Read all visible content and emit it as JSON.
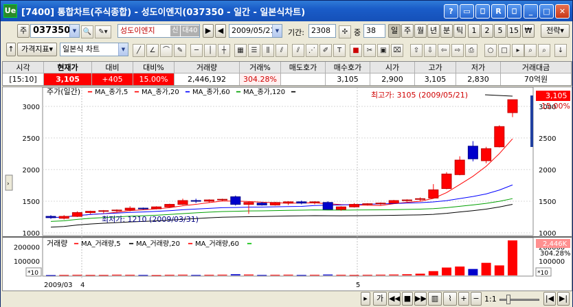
{
  "window": {
    "title": "[7400] 통합차트(주식종합) - 성도이엔지(037350 - 일간 - 일본식차트)",
    "app_icon_label": "Ue",
    "title_buttons": [
      "?",
      "▭",
      "⎕",
      "R",
      "⎕",
      "_",
      "□",
      "✕"
    ]
  },
  "toolbar1": {
    "market_prefix": "주",
    "code": "037350",
    "stock_name": "성도이엔지",
    "badge1": "신",
    "badge2": "대40",
    "date": "2009/05/21",
    "period_label": "기간:",
    "period_value": "2308",
    "count_label": "중",
    "count_value": "38",
    "period_buttons": [
      "일",
      "주",
      "월",
      "년",
      "분",
      "틱",
      "1",
      "2",
      "5",
      "15",
      "₩"
    ],
    "strategy_label": "전략"
  },
  "toolbar2": {
    "indicator_label": "가격지표",
    "chart_type": "일본식 차트"
  },
  "info": {
    "headers": [
      "시각",
      "현재가",
      "대비",
      "대비%",
      "거래량",
      "거래%",
      "매도호가",
      "매수호가",
      "시가",
      "고가",
      "저가",
      "거래대금"
    ],
    "values": [
      "[15:10]",
      "3,105",
      "+405",
      "15.00%",
      "2,446,192",
      "304.28%",
      "",
      "3,105",
      "2,900",
      "3,105",
      "2,830",
      "70억원"
    ]
  },
  "price_panel": {
    "title": "주가(일간)",
    "ma_labels": [
      "MA_종가,5",
      "MA_종가,20",
      "MA_종가,60",
      "MA_종가,120"
    ],
    "ma_colors": [
      "#ff0000",
      "#ff0000",
      "#0000ff",
      "#00a000",
      "#000000"
    ],
    "high_label": "최고가: 3105 (2009/05/21)",
    "low_label": "최저가: 1210 (2009/03/31)",
    "axis_ticks": [
      "3000",
      "2500",
      "2000",
      "1500",
      "1000"
    ],
    "last_price": "3,105",
    "last_pct": "15.00%"
  },
  "volume_panel": {
    "title": "거래량",
    "ma_labels": [
      "MA_거래량,5",
      "MA_거래량,20",
      "MA_거래량,60"
    ],
    "axis_ticks": [
      "200000",
      "100000"
    ],
    "multiplier": "*10",
    "last_volume": "2,446K",
    "last_pct": "304.28%"
  },
  "xaxis": {
    "labels": [
      "2009/03",
      "4",
      "5"
    ]
  },
  "bottombar": {
    "zoom": "1:1",
    "prefix": "가"
  },
  "chart_data": {
    "type": "candlestick",
    "ylim": [
      1000,
      3150
    ],
    "candles": [
      {
        "o": 1260,
        "h": 1280,
        "l": 1220,
        "c": 1240
      },
      {
        "o": 1230,
        "h": 1280,
        "l": 1210,
        "c": 1260
      },
      {
        "o": 1260,
        "h": 1340,
        "l": 1250,
        "c": 1320
      },
      {
        "o": 1320,
        "h": 1350,
        "l": 1300,
        "c": 1340
      },
      {
        "o": 1340,
        "h": 1360,
        "l": 1310,
        "c": 1350
      },
      {
        "o": 1350,
        "h": 1370,
        "l": 1330,
        "c": 1360
      },
      {
        "o": 1360,
        "h": 1420,
        "l": 1340,
        "c": 1390
      },
      {
        "o": 1390,
        "h": 1400,
        "l": 1370,
        "c": 1380
      },
      {
        "o": 1380,
        "h": 1420,
        "l": 1370,
        "c": 1410
      },
      {
        "o": 1410,
        "h": 1460,
        "l": 1400,
        "c": 1450
      },
      {
        "o": 1450,
        "h": 1540,
        "l": 1440,
        "c": 1510
      },
      {
        "o": 1510,
        "h": 1540,
        "l": 1470,
        "c": 1500
      },
      {
        "o": 1500,
        "h": 1530,
        "l": 1480,
        "c": 1520
      },
      {
        "o": 1520,
        "h": 1540,
        "l": 1500,
        "c": 1530
      },
      {
        "o": 1570,
        "h": 1590,
        "l": 1430,
        "c": 1450
      },
      {
        "o": 1450,
        "h": 1500,
        "l": 1300,
        "c": 1480
      },
      {
        "o": 1470,
        "h": 1490,
        "l": 1430,
        "c": 1440
      },
      {
        "o": 1440,
        "h": 1490,
        "l": 1430,
        "c": 1480
      },
      {
        "o": 1470,
        "h": 1500,
        "l": 1440,
        "c": 1490
      },
      {
        "o": 1490,
        "h": 1510,
        "l": 1450,
        "c": 1470
      },
      {
        "o": 1480,
        "h": 1500,
        "l": 1450,
        "c": 1490
      },
      {
        "o": 1480,
        "h": 1500,
        "l": 1370,
        "c": 1370
      },
      {
        "o": 1370,
        "h": 1420,
        "l": 1350,
        "c": 1410
      },
      {
        "o": 1410,
        "h": 1470,
        "l": 1400,
        "c": 1450
      },
      {
        "o": 1450,
        "h": 1470,
        "l": 1430,
        "c": 1460
      },
      {
        "o": 1460,
        "h": 1480,
        "l": 1440,
        "c": 1470
      },
      {
        "o": 1470,
        "h": 1520,
        "l": 1460,
        "c": 1510
      },
      {
        "o": 1510,
        "h": 1530,
        "l": 1490,
        "c": 1520
      },
      {
        "o": 1530,
        "h": 1560,
        "l": 1500,
        "c": 1540
      },
      {
        "o": 1550,
        "h": 1770,
        "l": 1540,
        "c": 1680
      },
      {
        "o": 1700,
        "h": 1960,
        "l": 1690,
        "c": 1930
      },
      {
        "o": 1920,
        "h": 2210,
        "l": 1910,
        "c": 2150
      },
      {
        "o": 2370,
        "h": 2450,
        "l": 2130,
        "c": 2170
      },
      {
        "o": 2140,
        "h": 2360,
        "l": 2100,
        "c": 2330
      },
      {
        "o": 2360,
        "h": 2700,
        "l": 2350,
        "c": 2680
      },
      {
        "o": 2900,
        "h": 3105,
        "l": 2830,
        "c": 3105
      }
    ],
    "volumes": [
      2,
      3,
      4,
      3,
      3,
      5,
      4,
      3,
      2,
      4,
      5,
      3,
      4,
      5,
      8,
      6,
      3,
      4,
      5,
      3,
      4,
      6,
      4,
      3,
      4,
      5,
      6,
      8,
      12,
      30,
      55,
      62,
      45,
      88,
      70,
      245
    ]
  }
}
